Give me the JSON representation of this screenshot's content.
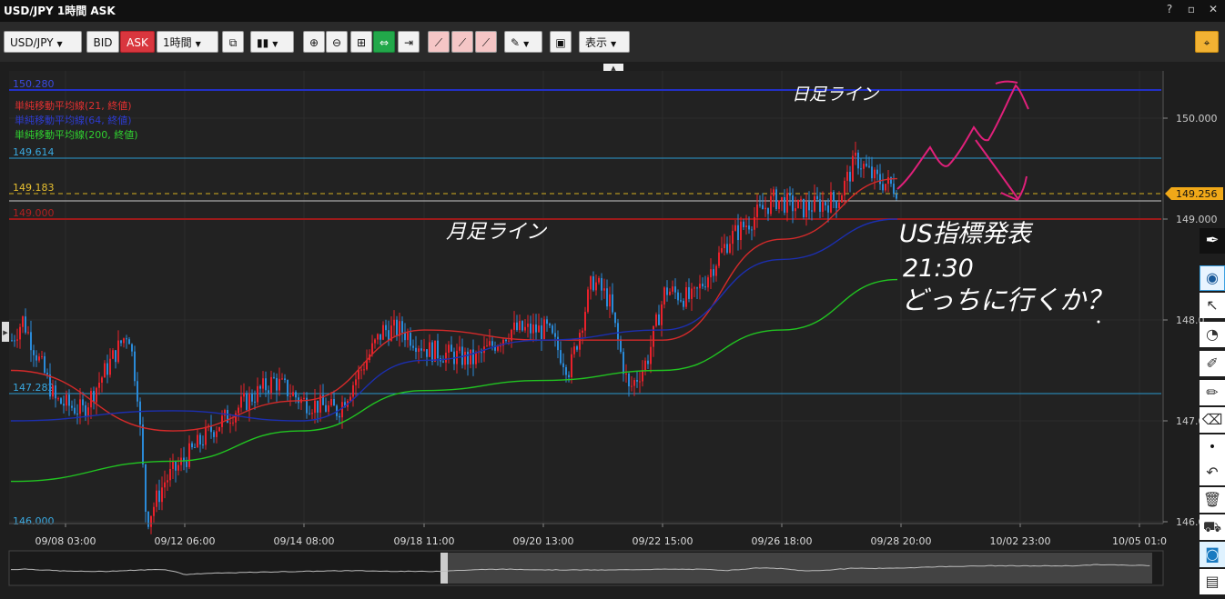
{
  "window": {
    "title": "USD/JPY 1時間 ASK"
  },
  "toolbar": {
    "symbol": "USD/JPY",
    "bid_label": "BID",
    "ask_label": "ASK",
    "timeframe": "1時間",
    "display_label": "表示"
  },
  "legend": {
    "ma21": "単純移動平均線(21, 終値)",
    "ma64": "単純移動平均線(64, 終値)",
    "ma200": "単純移動平均線(200, 終値)"
  },
  "price_axis": {
    "labels": [
      "150.000",
      "149.000",
      "148.0",
      "147.0",
      "146.0"
    ],
    "current_price": "149.256"
  },
  "lines": {
    "l150280": "150.280",
    "l149614": "149.614",
    "l149183": "149.183",
    "l149000": "149.000",
    "l147282": "147.282",
    "l146000": "146.000"
  },
  "time_axis": {
    "labels": [
      "09/08 03:00",
      "09/12 06:00",
      "09/14 08:00",
      "09/18 11:00",
      "09/20 13:00",
      "09/22 15:00",
      "09/26 18:00",
      "09/28 20:00",
      "10/02 23:00",
      "10/05 01:0"
    ]
  },
  "annotations": {
    "top_label": "日足ライン",
    "mid_label": "月足ライン",
    "note_line1": "US指標発表",
    "note_line2": "21:30",
    "note_line3": "どっちに行くか？"
  },
  "colors": {
    "bull": "#e8212b",
    "bear": "#2a8ad8",
    "ma21": "#d42a2a",
    "ma64": "#1c2fb0",
    "ma200": "#21c421",
    "hline_blue": "#2b9ad0",
    "hline_navy": "#2230c8",
    "hline_red": "#9c1a1a",
    "hline_yellow": "#d6b020",
    "pen": "#e0207a"
  },
  "chart_data": {
    "type": "line",
    "x": [
      "09/08 03:00",
      "09/12 06:00",
      "09/14 08:00",
      "09/18 11:00",
      "09/20 13:00",
      "09/22 15:00",
      "09/26 18:00",
      "09/28 20:00"
    ],
    "series": [
      {
        "name": "単純移動平均線(21, 終値)",
        "values": [
          147.5,
          146.9,
          147.2,
          147.9,
          147.8,
          147.8,
          148.8,
          149.4
        ]
      },
      {
        "name": "単純移動平均線(64, 終値)",
        "values": [
          147.0,
          147.1,
          147.0,
          147.6,
          147.8,
          147.9,
          148.6,
          149.0
        ]
      },
      {
        "name": "単純移動平均線(200, 終値)",
        "values": [
          146.4,
          146.6,
          146.9,
          147.3,
          147.4,
          147.5,
          147.9,
          148.4
        ]
      }
    ],
    "ylim": [
      146.0,
      150.4
    ]
  }
}
